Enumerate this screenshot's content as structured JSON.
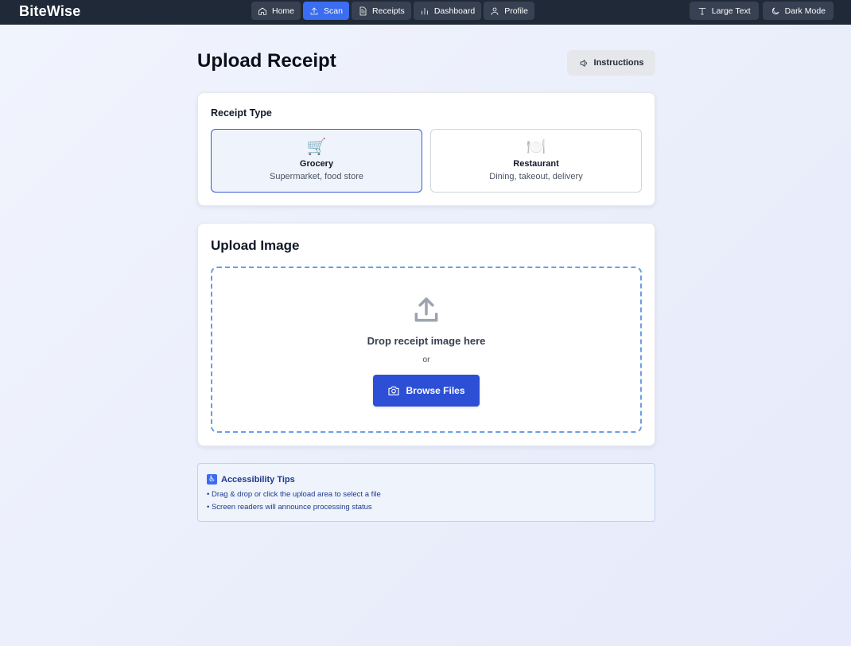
{
  "app": {
    "brand": "BiteWise"
  },
  "nav": {
    "items": [
      {
        "label": "Home",
        "icon": "home-icon",
        "active": false
      },
      {
        "label": "Scan",
        "icon": "upload-icon",
        "active": true
      },
      {
        "label": "Receipts",
        "icon": "document-icon",
        "active": false
      },
      {
        "label": "Dashboard",
        "icon": "bar-chart-icon",
        "active": false
      },
      {
        "label": "Profile",
        "icon": "user-icon",
        "active": false
      }
    ],
    "right": [
      {
        "label": "Large Text",
        "icon": "text-size-icon"
      },
      {
        "label": "Dark Mode",
        "icon": "moon-icon"
      }
    ]
  },
  "page": {
    "title": "Upload Receipt",
    "instructions_label": "Instructions"
  },
  "receipt_type": {
    "label": "Receipt Type",
    "options": [
      {
        "emoji": "🛒",
        "name": "Grocery",
        "desc": "Supermarket, food store",
        "selected": true
      },
      {
        "emoji": "🍽️",
        "name": "Restaurant",
        "desc": "Dining, takeout, delivery",
        "selected": false
      }
    ]
  },
  "upload": {
    "heading": "Upload Image",
    "drop_text": "Drop receipt image here",
    "or_text": "or",
    "browse_label": "Browse Files"
  },
  "tips": {
    "icon": "♿",
    "title": "Accessibility Tips",
    "items": [
      "• Drag & drop or click the upload area to select a file",
      "• Screen readers will announce processing status"
    ]
  },
  "colors": {
    "nav_bg": "#1f2937",
    "accent": "#3b6df1",
    "button_primary": "#2d4fd6",
    "dropzone_border": "#6a9ee8"
  }
}
